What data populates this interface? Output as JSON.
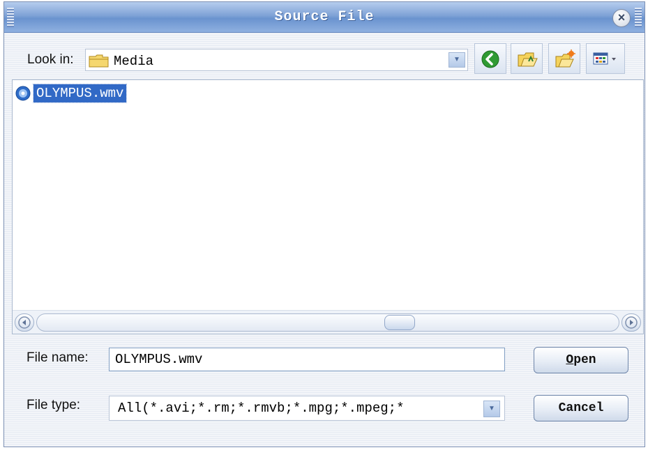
{
  "window": {
    "title": "Source File"
  },
  "look_in": {
    "label": "Look in:",
    "value": "Media",
    "folder_icon": "folder-icon",
    "dropdown_icon": "chevron-down-icon"
  },
  "toolbar": {
    "buttons": [
      {
        "name": "back",
        "icon": "back-arrow-icon"
      },
      {
        "name": "up-folder",
        "icon": "folder-up-icon"
      },
      {
        "name": "new-folder",
        "icon": "new-folder-icon"
      },
      {
        "name": "view-menu",
        "icon": "view-menu-icon"
      }
    ]
  },
  "file_list": {
    "items": [
      {
        "name": "OLYMPUS.wmv",
        "icon": "media-file-icon",
        "selected": true
      }
    ]
  },
  "fields": {
    "file_name_label": "File name:",
    "file_name_value": "OLYMPUS.wmv",
    "file_type_label": "File type:",
    "file_type_value": "All(*.avi;*.rm;*.rmvb;*.mpg;*.mpeg;*"
  },
  "buttons": {
    "open": "Open",
    "cancel": "Cancel"
  },
  "colors": {
    "title_bar": "#7fa2d6",
    "selection": "#3169c6",
    "back_button": "#2f9a33"
  }
}
